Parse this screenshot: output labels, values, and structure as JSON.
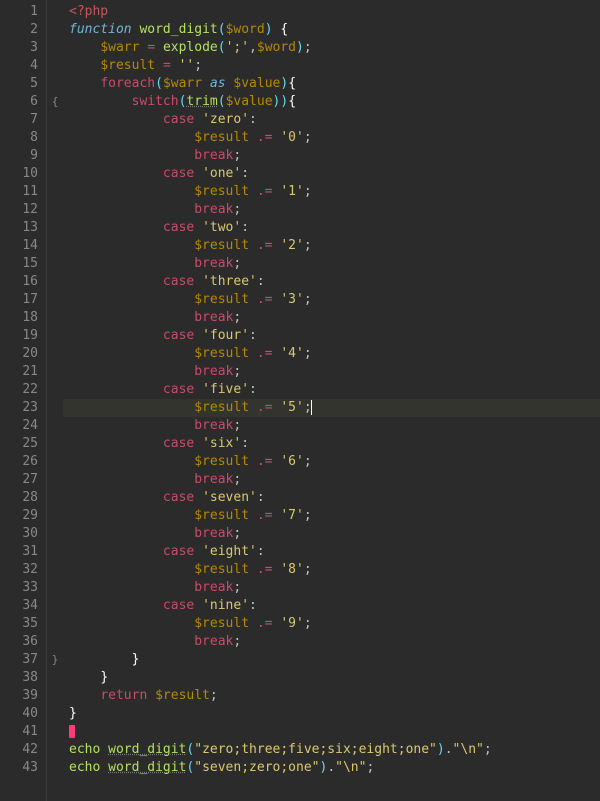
{
  "fold": {
    "6": "{",
    "37": "}"
  },
  "current_line": 23,
  "lines": [
    {
      "n": 1,
      "tokens": [
        "spec:<?php"
      ]
    },
    {
      "n": 2,
      "tokens": [
        "kw:function",
        "txt: ",
        "fn:word_digit",
        "op2:(",
        "var:$word",
        "op2:)",
        "txt: ",
        "white:{"
      ]
    },
    {
      "n": 3,
      "indent": 1,
      "tokens": [
        "var:$warr",
        "txt: ",
        "op:=",
        "txt: ",
        "fn:explode",
        "op2:(",
        "str:';'",
        "punc:,",
        "var:$word",
        "op2:)",
        "punc:;"
      ]
    },
    {
      "n": 4,
      "indent": 1,
      "tokens": [
        "var:$result",
        "txt: ",
        "op:=",
        "txt: ",
        "str:''",
        "punc:;"
      ]
    },
    {
      "n": 5,
      "indent": 1,
      "tokens": [
        "kw2:foreach",
        "op2:(",
        "var:$warr",
        "txt: ",
        "kw:as",
        "txt: ",
        "var:$value",
        "op2:)",
        "white:{"
      ]
    },
    {
      "n": 6,
      "indent": 2,
      "tokens": [
        "kw2:switch",
        "op2:(",
        "fnu:trim",
        "op2:(",
        "var:$value",
        "op2:)",
        "op2:)",
        "white:{"
      ]
    },
    {
      "n": 7,
      "indent": 3,
      "tokens": [
        "kw2:case",
        "txt: ",
        "str:'zero'",
        "punc::"
      ]
    },
    {
      "n": 8,
      "indent": 4,
      "tokens": [
        "var:$result",
        "txt: ",
        "op:.=",
        "txt: ",
        "str:'0'",
        "punc:;"
      ]
    },
    {
      "n": 9,
      "indent": 4,
      "tokens": [
        "kw2:break",
        "punc:;"
      ]
    },
    {
      "n": 10,
      "indent": 3,
      "tokens": [
        "kw2:case",
        "txt: ",
        "str:'one'",
        "punc::"
      ]
    },
    {
      "n": 11,
      "indent": 4,
      "tokens": [
        "var:$result",
        "txt: ",
        "op:.=",
        "txt: ",
        "str:'1'",
        "punc:;"
      ]
    },
    {
      "n": 12,
      "indent": 4,
      "tokens": [
        "kw2:break",
        "punc:;"
      ]
    },
    {
      "n": 13,
      "indent": 3,
      "tokens": [
        "kw2:case",
        "txt: ",
        "str:'two'",
        "punc::"
      ]
    },
    {
      "n": 14,
      "indent": 4,
      "tokens": [
        "var:$result",
        "txt: ",
        "op:.=",
        "txt: ",
        "str:'2'",
        "punc:;"
      ]
    },
    {
      "n": 15,
      "indent": 4,
      "tokens": [
        "kw2:break",
        "punc:;"
      ]
    },
    {
      "n": 16,
      "indent": 3,
      "tokens": [
        "kw2:case",
        "txt: ",
        "str:'three'",
        "punc::"
      ]
    },
    {
      "n": 17,
      "indent": 4,
      "tokens": [
        "var:$result",
        "txt: ",
        "op:.=",
        "txt: ",
        "str:'3'",
        "punc:;"
      ]
    },
    {
      "n": 18,
      "indent": 4,
      "tokens": [
        "kw2:break",
        "punc:;"
      ]
    },
    {
      "n": 19,
      "indent": 3,
      "tokens": [
        "kw2:case",
        "txt: ",
        "str:'four'",
        "punc::"
      ]
    },
    {
      "n": 20,
      "indent": 4,
      "tokens": [
        "var:$result",
        "txt: ",
        "op:.=",
        "txt: ",
        "str:'4'",
        "punc:;"
      ]
    },
    {
      "n": 21,
      "indent": 4,
      "tokens": [
        "kw2:break",
        "punc:;"
      ]
    },
    {
      "n": 22,
      "indent": 3,
      "tokens": [
        "kw2:case",
        "txt: ",
        "str:'five'",
        "punc::"
      ]
    },
    {
      "n": 23,
      "indent": 4,
      "tokens": [
        "var:$result",
        "txt: ",
        "op:.=",
        "txt: ",
        "str:'5'",
        "punc:;"
      ],
      "caret": true
    },
    {
      "n": 24,
      "indent": 4,
      "tokens": [
        "kw2:break",
        "punc:;"
      ]
    },
    {
      "n": 25,
      "indent": 3,
      "tokens": [
        "kw2:case",
        "txt: ",
        "str:'six'",
        "punc::"
      ]
    },
    {
      "n": 26,
      "indent": 4,
      "tokens": [
        "var:$result",
        "txt: ",
        "op:.=",
        "txt: ",
        "str:'6'",
        "punc:;"
      ]
    },
    {
      "n": 27,
      "indent": 4,
      "tokens": [
        "kw2:break",
        "punc:;"
      ]
    },
    {
      "n": 28,
      "indent": 3,
      "tokens": [
        "kw2:case",
        "txt: ",
        "str:'seven'",
        "punc::"
      ]
    },
    {
      "n": 29,
      "indent": 4,
      "tokens": [
        "var:$result",
        "txt: ",
        "op:.=",
        "txt: ",
        "str:'7'",
        "punc:;"
      ]
    },
    {
      "n": 30,
      "indent": 4,
      "tokens": [
        "kw2:break",
        "punc:;"
      ]
    },
    {
      "n": 31,
      "indent": 3,
      "tokens": [
        "kw2:case",
        "txt: ",
        "str:'eight'",
        "punc::"
      ]
    },
    {
      "n": 32,
      "indent": 4,
      "tokens": [
        "var:$result",
        "txt: ",
        "op:.=",
        "txt: ",
        "str:'8'",
        "punc:;"
      ]
    },
    {
      "n": 33,
      "indent": 4,
      "tokens": [
        "kw2:break",
        "punc:;"
      ]
    },
    {
      "n": 34,
      "indent": 3,
      "tokens": [
        "kw2:case",
        "txt: ",
        "str:'nine'",
        "punc::"
      ]
    },
    {
      "n": 35,
      "indent": 4,
      "tokens": [
        "var:$result",
        "txt: ",
        "op:.=",
        "txt: ",
        "str:'9'",
        "punc:;"
      ]
    },
    {
      "n": 36,
      "indent": 4,
      "tokens": [
        "kw2:break",
        "punc:;"
      ]
    },
    {
      "n": 37,
      "indent": 2,
      "tokens": [
        "white:}"
      ]
    },
    {
      "n": 38,
      "indent": 1,
      "tokens": [
        "white:}"
      ]
    },
    {
      "n": 39,
      "indent": 1,
      "tokens": [
        "kw2:return",
        "txt: ",
        "var:$result",
        "punc:;"
      ]
    },
    {
      "n": 40,
      "tokens": [
        "white:}"
      ]
    },
    {
      "n": 41,
      "tokens": [
        "pink:"
      ]
    },
    {
      "n": 42,
      "tokens": [
        "fn:echo",
        "txt: ",
        "fnu:word_digit",
        "op2:(",
        "str:\"zero;three;five;six;eight;one\"",
        "op2:)",
        "punc:.",
        "str:\"\\n\"",
        "punc:;"
      ]
    },
    {
      "n": 43,
      "tokens": [
        "fn:echo",
        "txt: ",
        "fnu:word_digit",
        "op2:(",
        "str:\"seven;zero;one\"",
        "op2:)",
        "punc:.",
        "str:\"\\n\"",
        "punc:;"
      ]
    }
  ]
}
